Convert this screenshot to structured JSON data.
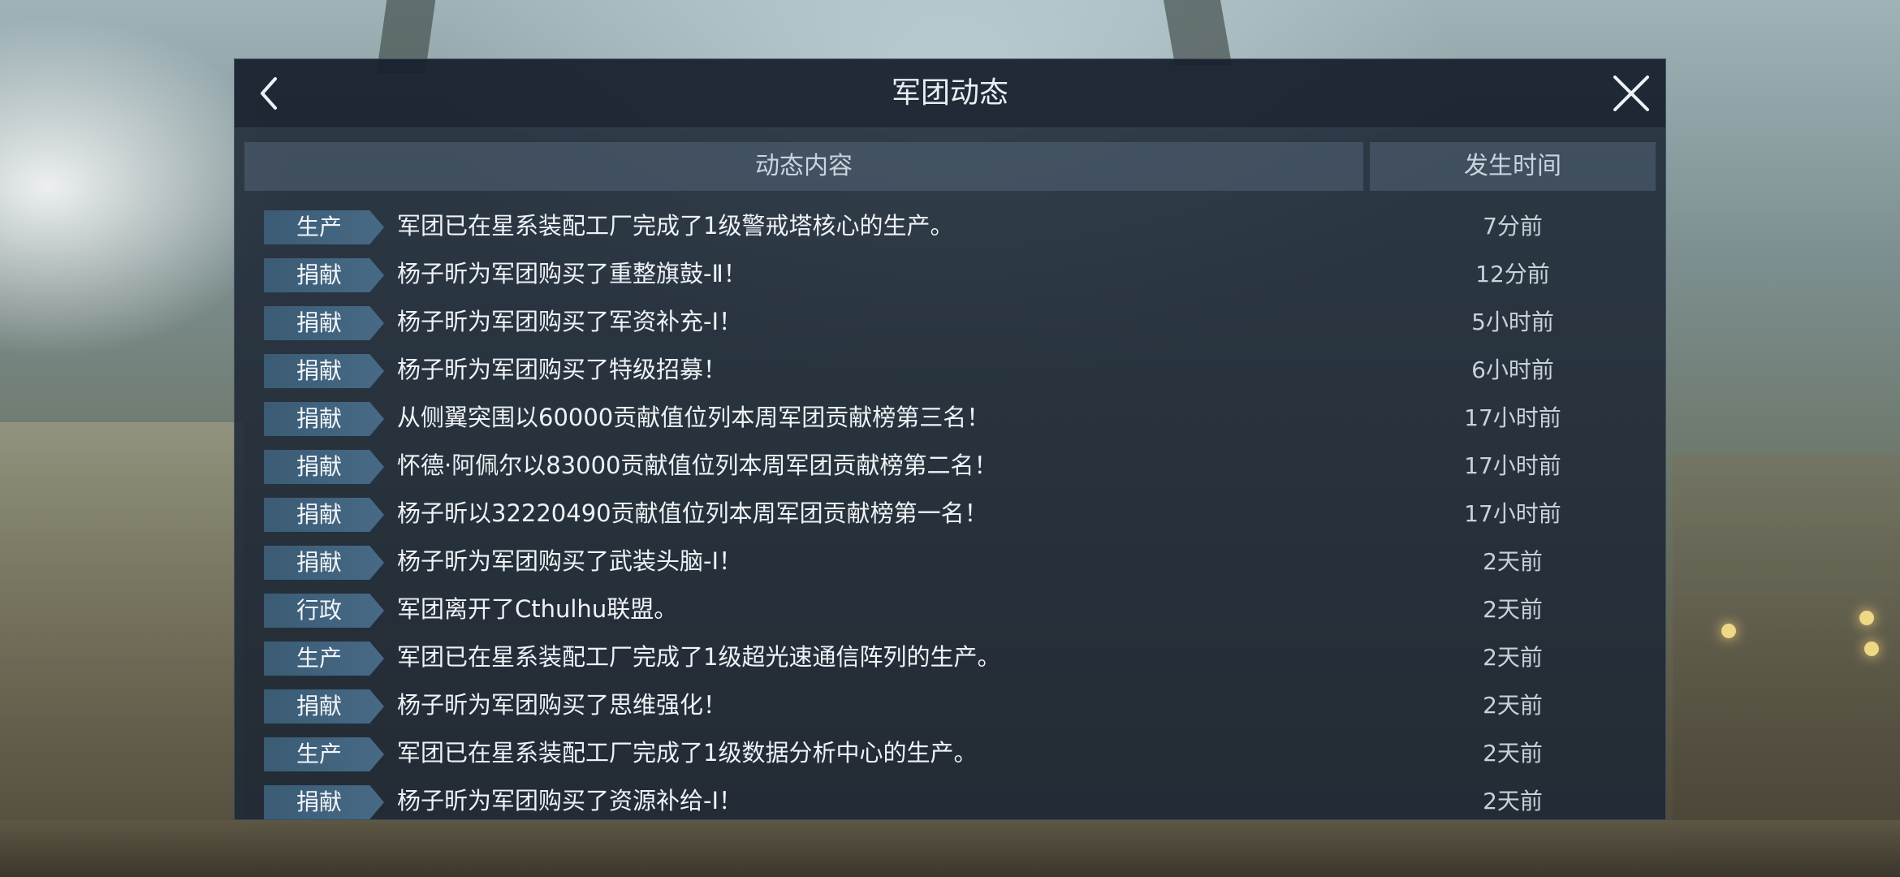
{
  "window": {
    "title": "军团动态"
  },
  "table": {
    "headers": {
      "content": "动态内容",
      "time": "发生时间"
    },
    "rows": [
      {
        "tag": "生产",
        "text": "军团已在星系装配工厂完成了1级警戒塔核心的生产。",
        "time": "7分前"
      },
      {
        "tag": "捐献",
        "text": "杨子昕为军团购买了重整旗鼓-Ⅱ！",
        "time": "12分前"
      },
      {
        "tag": "捐献",
        "text": "杨子昕为军团购买了军资补充-Ⅰ！",
        "time": "5小时前"
      },
      {
        "tag": "捐献",
        "text": "杨子昕为军团购买了特级招募！",
        "time": "6小时前"
      },
      {
        "tag": "捐献",
        "text": "从侧翼突围以60000贡献值位列本周军团贡献榜第三名！",
        "time": "17小时前"
      },
      {
        "tag": "捐献",
        "text": "怀德·阿佩尔以83000贡献值位列本周军团贡献榜第二名！",
        "time": "17小时前"
      },
      {
        "tag": "捐献",
        "text": "杨子昕以32220490贡献值位列本周军团贡献榜第一名！",
        "time": "17小时前"
      },
      {
        "tag": "捐献",
        "text": "杨子昕为军团购买了武装头脑-Ⅰ！",
        "time": "2天前"
      },
      {
        "tag": "行政",
        "text": "军团离开了Cthulhu联盟。",
        "time": "2天前"
      },
      {
        "tag": "生产",
        "text": "军团已在星系装配工厂完成了1级超光速通信阵列的生产。",
        "time": "2天前"
      },
      {
        "tag": "捐献",
        "text": "杨子昕为军团购买了思维强化！",
        "time": "2天前"
      },
      {
        "tag": "生产",
        "text": "军团已在星系装配工厂完成了1级数据分析中心的生产。",
        "time": "2天前"
      },
      {
        "tag": "捐献",
        "text": "杨子昕为军团购买了资源补给-Ⅰ！",
        "time": "2天前"
      }
    ]
  },
  "icons": {
    "back": "chevron-left-icon",
    "close": "close-icon"
  },
  "colors": {
    "panel_bg": "#1c2634",
    "tag_bg": "#3b5b74",
    "header_bg": "#5a6c80",
    "text": "#eef2f6"
  }
}
